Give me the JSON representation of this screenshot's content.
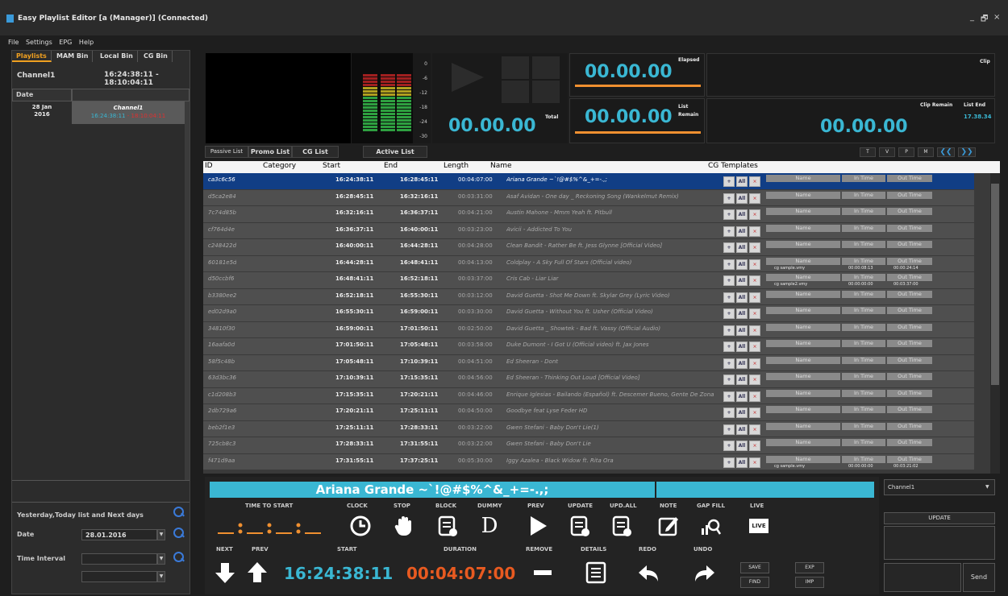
{
  "app": {
    "title": "Easy Playlist Editor [a (Manager)] (Connected)",
    "window_controls": [
      "_",
      "🗗",
      "×"
    ]
  },
  "menu": [
    "File",
    "Settings",
    "EPG",
    "Help"
  ],
  "left": {
    "tabs": [
      "Playlists",
      "MAM Bin",
      "Local Bin",
      "CG Bin"
    ],
    "channel": "Channel1",
    "channel_time": "16:24:38:11 - 18:10:04:11",
    "date_header": "Date",
    "date_day": "28 Jan",
    "date_year": "2016",
    "box_channel": "Channel1",
    "box_start": "16:24:38:11",
    "box_sep": " - ",
    "box_end": "18:10:04:11",
    "yesterday_label": "Yesterday,Today list and Next days",
    "date_label": "Date",
    "date_value": "28.01.2016",
    "interval_label": "Time Interval"
  },
  "preview": {
    "vu_scale": [
      "0",
      "-6",
      "-12",
      "-18",
      "-24",
      "-30"
    ],
    "total_time": "00.00.00",
    "total_label": "Total",
    "elapsed_time": "00.00.00",
    "elapsed_label": "Elapsed",
    "list_time": "00.00.00",
    "list_label1": "List",
    "list_label2": "Remain",
    "clip_label": "Clip",
    "clip_remain_label": "Clip Remain",
    "list_end_label": "List End",
    "list_end_value": "17.38.34",
    "clip_remain_time": "00.00.00"
  },
  "list_tabs": [
    "Passive List",
    "Promo List",
    "CG List",
    "Active List"
  ],
  "right_buttons": [
    "T",
    "V",
    "P",
    "M"
  ],
  "nav": [
    "❮❮",
    "❯❯"
  ],
  "grid": {
    "headers": {
      "id": "ID",
      "category": "Category",
      "start": "Start",
      "end": "End",
      "length": "Length",
      "name": "Name",
      "cg": "CG Templates"
    },
    "cg_buttons": [
      "+",
      "All",
      "×"
    ],
    "cg_cols": [
      "Name",
      "In Time",
      "Out Time"
    ],
    "rows": [
      {
        "id": "ca3c6c56",
        "start": "16:24:38:11",
        "end": "16:28:45:11",
        "length": "00:04:07:00",
        "name": "Ariana Grande ~`!@#$%^&_+=-.,;",
        "sub": null
      },
      {
        "id": "d5ca2e84",
        "start": "16:28:45:11",
        "end": "16:32:16:11",
        "length": "00:03:31:00",
        "name": "Asaf Avidan - One day _ Reckoning Song (Wankelmut Remix)",
        "sub": null
      },
      {
        "id": "7c74d85b",
        "start": "16:32:16:11",
        "end": "16:36:37:11",
        "length": "00:04:21:00",
        "name": "Austin Mahone - Mmm Yeah ft. Pitbull",
        "sub": null
      },
      {
        "id": "cf764d4e",
        "start": "16:36:37:11",
        "end": "16:40:00:11",
        "length": "00:03:23:00",
        "name": "Avicii - Addicted To You",
        "sub": null
      },
      {
        "id": "c248422d",
        "start": "16:40:00:11",
        "end": "16:44:28:11",
        "length": "00:04:28:00",
        "name": "Clean Bandit - Rather Be ft. Jess Glynne [Official Video]",
        "sub": null
      },
      {
        "id": "60181e5d",
        "start": "16:44:28:11",
        "end": "16:48:41:11",
        "length": "00:04:13:00",
        "name": "Coldplay - A Sky Full Of Stars (Official video)",
        "sub": {
          "name": "cg sample.vmy",
          "in": "00:00:08:13",
          "out": "00:00:24:14"
        }
      },
      {
        "id": "d50ccbf6",
        "start": "16:48:41:11",
        "end": "16:52:18:11",
        "length": "00:03:37:00",
        "name": "Cris Cab - Liar Liar",
        "sub": {
          "name": "cg sample2.vmy",
          "in": "00:00:00:00",
          "out": "00:03:37:00"
        }
      },
      {
        "id": "b3380ee2",
        "start": "16:52:18:11",
        "end": "16:55:30:11",
        "length": "00:03:12:00",
        "name": "David Guetta - Shot Me Down ft. Skylar Grey (Lyric Video)",
        "sub": null
      },
      {
        "id": "ed02d9a0",
        "start": "16:55:30:11",
        "end": "16:59:00:11",
        "length": "00:03:30:00",
        "name": "David Guetta - Without You ft. Usher (Official Video)",
        "sub": null
      },
      {
        "id": "34810f30",
        "start": "16:59:00:11",
        "end": "17:01:50:11",
        "length": "00:02:50:00",
        "name": "David Guetta _ Showtek - Bad ft. Vassy (Official Audio)",
        "sub": null
      },
      {
        "id": "16aafa0d",
        "start": "17:01:50:11",
        "end": "17:05:48:11",
        "length": "00:03:58:00",
        "name": "Duke Dumont - I Got U (Official video) ft. Jax Jones",
        "sub": null
      },
      {
        "id": "58f5c48b",
        "start": "17:05:48:11",
        "end": "17:10:39:11",
        "length": "00:04:51:00",
        "name": "Ed Sheeran - Dont",
        "sub": null
      },
      {
        "id": "63d3bc36",
        "start": "17:10:39:11",
        "end": "17:15:35:11",
        "length": "00:04:56:00",
        "name": "Ed Sheeran - Thinking Out Loud [Official Video]",
        "sub": null
      },
      {
        "id": "c1d208b3",
        "start": "17:15:35:11",
        "end": "17:20:21:11",
        "length": "00:04:46:00",
        "name": "Enrique Iglesias - Bailando (Español) ft. Descemer Bueno, Gente De Zona",
        "sub": null
      },
      {
        "id": "2db729a6",
        "start": "17:20:21:11",
        "end": "17:25:11:11",
        "length": "00:04:50:00",
        "name": "Goodbye feat Lyse Feder HD",
        "sub": null
      },
      {
        "id": "beb2f1e3",
        "start": "17:25:11:11",
        "end": "17:28:33:11",
        "length": "00:03:22:00",
        "name": "Gwen Stefani - Baby Don't Lie(1)",
        "sub": null
      },
      {
        "id": "725cb8c3",
        "start": "17:28:33:11",
        "end": "17:31:55:11",
        "length": "00:03:22:00",
        "name": "Gwen Stefani - Baby Don't Lie",
        "sub": null
      },
      {
        "id": "f471d9aa",
        "start": "17:31:55:11",
        "end": "17:37:25:11",
        "length": "00:05:30:00",
        "name": "Iggy Azalea - Black Widow ft. Rita Ora",
        "sub": {
          "name": "cg sample.vmy",
          "in": "00:00:00:00",
          "out": "00:03:21:02"
        }
      }
    ]
  },
  "control": {
    "now_title": "Ariana Grande ~`!@#$%^&_+=-.,;",
    "labels": {
      "time_to_start": "TIME TO START",
      "clock": "CLOCK",
      "stop": "STOP",
      "block": "BLOCK",
      "dummy": "DUMMY",
      "prev": "PREV",
      "update": "UPDATE",
      "upd_all": "UPD.ALL",
      "note": "NOTE",
      "gap_fill": "GAP FILL",
      "live": "LIVE",
      "next": "NEXT",
      "prev2": "PREV",
      "start": "START",
      "duration": "DURATION",
      "remove": "REMOVE",
      "details": "DETAILS",
      "redo": "REDO",
      "undo": "UNDO"
    },
    "start_value": "16:24:38:11",
    "duration_value": "00:04:07:00",
    "save": "SAVE",
    "find": "FIND",
    "exp": "EXP",
    "imp": "IMP",
    "dummy_glyph": "D",
    "live_glyph": "LIVE"
  },
  "right": {
    "channel": "Channel1",
    "update": "UPDATE",
    "send": "Send"
  }
}
